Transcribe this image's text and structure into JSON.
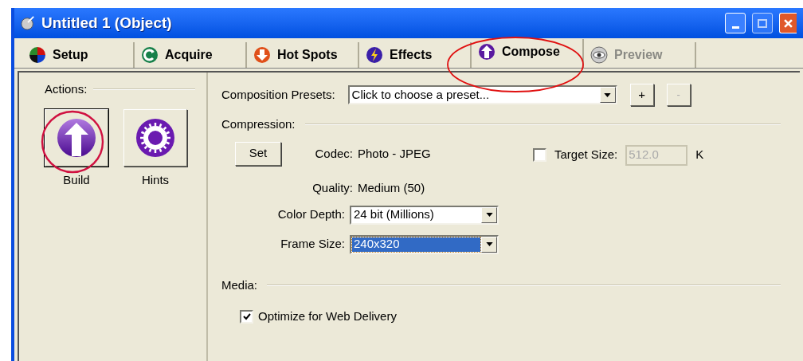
{
  "window": {
    "title": "Untitled 1 (Object)"
  },
  "tabs": [
    {
      "label": "Setup",
      "selected": false,
      "disabled": false
    },
    {
      "label": "Acquire",
      "selected": false,
      "disabled": false
    },
    {
      "label": "Hot Spots",
      "selected": false,
      "disabled": false
    },
    {
      "label": "Effects",
      "selected": false,
      "disabled": false
    },
    {
      "label": "Compose",
      "selected": true,
      "disabled": false
    },
    {
      "label": "Preview",
      "selected": false,
      "disabled": true
    }
  ],
  "actions": {
    "label": "Actions:",
    "buttons": [
      {
        "label": "Build",
        "selected": true
      },
      {
        "label": "Hints",
        "selected": false
      }
    ]
  },
  "presets": {
    "label": "Composition Presets:",
    "placeholder": "Click to choose a preset...",
    "add": "+",
    "remove": "-",
    "remove_disabled": true
  },
  "compression": {
    "label": "Compression:",
    "set": "Set",
    "fields": [
      {
        "label": "Codec:",
        "value": "Photo - JPEG"
      },
      {
        "label": "Quality:",
        "value": "Medium (50)"
      }
    ],
    "target": {
      "label": "Target Size:",
      "checked": false,
      "value": "512.0",
      "unit": "K",
      "disabled": true
    },
    "selects": [
      {
        "label": "Color Depth:",
        "value": "24 bit (Millions)",
        "highlighted": false
      },
      {
        "label": "Frame Size:",
        "value": "240x320",
        "highlighted": true
      }
    ]
  },
  "media": {
    "label": "Media:",
    "options": [
      {
        "label": "Optimize for Web Delivery",
        "checked": true
      }
    ]
  }
}
